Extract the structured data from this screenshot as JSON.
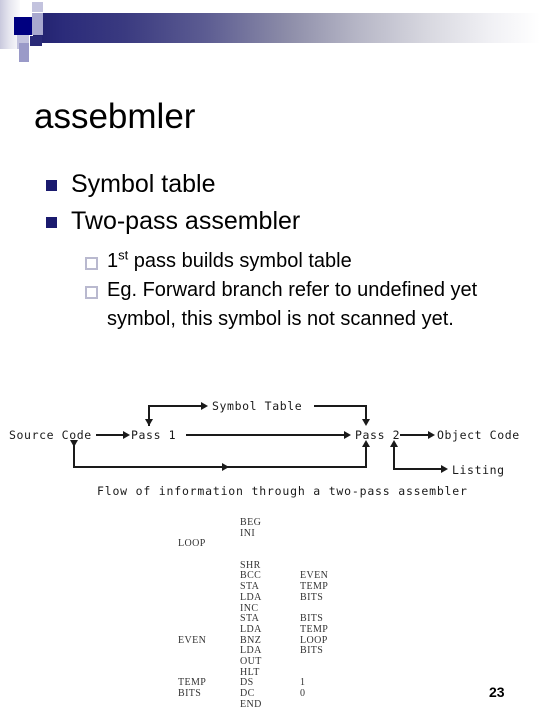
{
  "slide": {
    "title": "assebmler",
    "page_number": "23"
  },
  "bullets": [
    {
      "text": "Symbol table"
    },
    {
      "text": "Two-pass assembler"
    }
  ],
  "subbullets": [
    {
      "prefix": "1",
      "sup": "st",
      "text": " pass builds symbol table"
    },
    {
      "prefix": "",
      "sup": "",
      "text": "Eg. Forward branch refer to undefined yet symbol, this symbol is not scanned yet."
    }
  ],
  "diagram": {
    "caption": "Flow of information through a two-pass assembler",
    "nodes": {
      "source_code": "Source Code",
      "pass1": "Pass 1",
      "symbol_table": "Symbol Table",
      "pass2": "Pass 2",
      "object_code": "Object Code",
      "listing": "Listing"
    }
  },
  "code_listing": {
    "columns": [
      "label",
      "mnemonic",
      "operand"
    ],
    "rows": [
      {
        "label": "",
        "mnemonic": "BEG",
        "operand": ""
      },
      {
        "label": "",
        "mnemonic": "INI",
        "operand": ""
      },
      {
        "label": "LOOP",
        "mnemonic": "",
        "operand": ""
      },
      {
        "label": "",
        "mnemonic": "",
        "operand": ""
      },
      {
        "label": "",
        "mnemonic": "SHR",
        "operand": ""
      },
      {
        "label": "",
        "mnemonic": "BCC",
        "operand": "EVEN"
      },
      {
        "label": "",
        "mnemonic": "STA",
        "operand": "TEMP"
      },
      {
        "label": "",
        "mnemonic": "LDA",
        "operand": "BITS"
      },
      {
        "label": "",
        "mnemonic": "INC",
        "operand": ""
      },
      {
        "label": "",
        "mnemonic": "STA",
        "operand": "BITS"
      },
      {
        "label": "",
        "mnemonic": "LDA",
        "operand": "TEMP"
      },
      {
        "label": "EVEN",
        "mnemonic": "BNZ",
        "operand": "LOOP"
      },
      {
        "label": "",
        "mnemonic": "LDA",
        "operand": "BITS"
      },
      {
        "label": "",
        "mnemonic": "OUT",
        "operand": ""
      },
      {
        "label": "",
        "mnemonic": "HLT",
        "operand": ""
      },
      {
        "label": "TEMP",
        "mnemonic": "DS",
        "operand": "1"
      },
      {
        "label": "BITS",
        "mnemonic": "DC",
        "operand": "0"
      },
      {
        "label": "",
        "mnemonic": "END",
        "operand": ""
      }
    ]
  },
  "colors": {
    "bullet_navy": "#1a1a6e",
    "gradient_start": "#21216e",
    "gradient_end": "#ffffff",
    "deco_square": "#000080"
  }
}
